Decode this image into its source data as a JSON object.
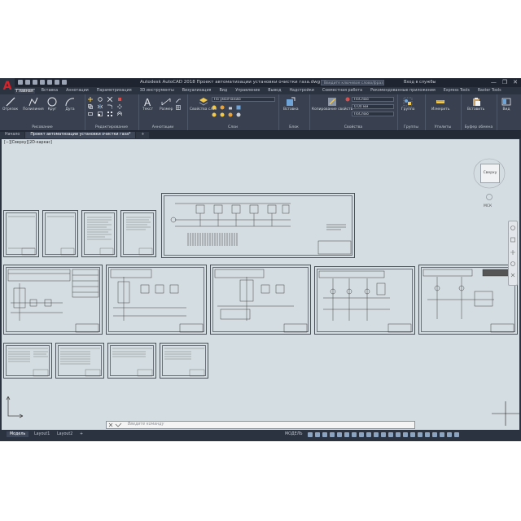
{
  "app": {
    "logo": "A",
    "title": "Autodesk AutoCAD 2018   Проект автоматизации установки очистки газа.dwg",
    "search_placeholder": "Введите ключевое слово/фразу",
    "sign_in": "Вход в службы",
    "window_controls": [
      "—",
      "❐",
      "✕"
    ]
  },
  "ribbon_tabs": [
    "Главная",
    "Вставка",
    "Аннотации",
    "Параметризация",
    "3D инструменты",
    "Визуализация",
    "Вид",
    "Управление",
    "Вывод",
    "Надстройки",
    "Совместная работа",
    "Рекомендованные приложения",
    "Express Tools",
    "Raster Tools"
  ],
  "ribbon": {
    "draw_tools": [
      "Отрезок",
      "Полилиния",
      "Круг",
      "Дуга"
    ],
    "draw_panel": "Рисование",
    "modify_panel": "Редактирование",
    "annotation_tools": [
      "Текст",
      "Размер"
    ],
    "annotation_panel": "Аннотации",
    "layers_tool": "Свойства слоя",
    "layer_value": "По умолчанию",
    "layers_panel": "Слои",
    "block_tool": "Вставка",
    "block_panel": "Блок",
    "match_properties": "Копирование свойств",
    "prop_color": "ПоСлою",
    "prop_lineweight": "0.00 мм",
    "prop_linetype": "ПоСлою",
    "properties_panel": "Свойства",
    "group_tool": "Группа",
    "groups_panel": "Группы",
    "measure_tool": "Измерить",
    "utilities_panel": "Утилиты",
    "paste_tool": "Вставить",
    "clipboard_panel": "Буфер обмена",
    "view_tool": "Вид"
  },
  "doc_tabs": [
    "Начало",
    "Проект автоматизации установки очистки газа*",
    "+"
  ],
  "viewport": {
    "label": "[−][Сверху][2D-каркас]",
    "viewcube": "Сверху",
    "viewcube_compass": "МСК"
  },
  "command_line": {
    "placeholder": "Введите команду"
  },
  "layout_tabs": [
    "Модель",
    "Layout1",
    "Layout2",
    "+"
  ],
  "status": {
    "model": "МОДЕЛЬ"
  }
}
